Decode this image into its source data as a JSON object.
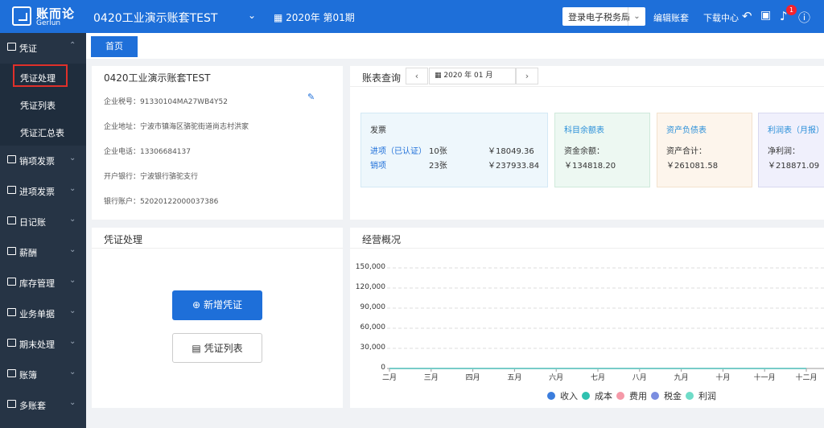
{
  "header": {
    "logo_cn": "账而论",
    "logo_en": "Gerlun",
    "company": "0420工业演示账套TEST",
    "period": "2020年 第01期",
    "login_tax": "登录电子税务局",
    "edit_ledger": "编辑账套",
    "download": "下载中心",
    "notify_count": "1"
  },
  "sidebar": {
    "voucher": "凭证",
    "voucher_process": "凭证处理",
    "voucher_list": "凭证列表",
    "voucher_summary": "凭证汇总表",
    "sales_invoice": "销项发票",
    "purchase_invoice": "进项发票",
    "journal": "日记账",
    "salary": "薪酬",
    "inventory": "库存管理",
    "business_docs": "业务单据",
    "period_end": "期末处理",
    "books": "账簿",
    "multi_ledger": "多账套"
  },
  "tabs": {
    "home": "首页"
  },
  "company_info": {
    "title": "0420工业演示账套TEST",
    "tax_id": "企业税号：91330104MA27WB4Y52",
    "address": "企业地址：宁波市镇海区骆驼街道尚志村洪家",
    "phone": "企业电话：13306684137",
    "bank": "开户银行：宁波银行骆驼支行",
    "account": "银行账户：52020122000037386"
  },
  "ledger_query": {
    "title": "账表查询",
    "date": "2020 年 01 月",
    "invoice": {
      "title": "发票",
      "in_label": "进项（已认证）",
      "in_count": "10张",
      "in_amount": "￥18049.36",
      "out_label": "销项",
      "out_count": "23张",
      "out_amount": "￥237933.84"
    },
    "balance": {
      "title": "科目余额表",
      "label": "资金余额：",
      "value": "￥134818.20"
    },
    "assets": {
      "title": "资产负债表",
      "label": "资产合计：",
      "value": "￥261081.58"
    },
    "profit": {
      "title": "利润表（月报）",
      "label": "净利润：",
      "value": "￥218871.09"
    }
  },
  "voucher_card": {
    "title": "凭证处理",
    "new_voucher": "新增凭证",
    "voucher_list": "凭证列表"
  },
  "chart_data": {
    "type": "line",
    "title": "经营概况",
    "categories": [
      "二月",
      "三月",
      "四月",
      "五月",
      "六月",
      "七月",
      "八月",
      "九月",
      "十月",
      "十一月",
      "十二月"
    ],
    "y_ticks": [
      "0",
      "30,000",
      "60,000",
      "90,000",
      "120,000",
      "150,000"
    ],
    "ylim": [
      0,
      150000
    ],
    "grid": true,
    "legend_position": "bottom",
    "series": [
      {
        "name": "收入",
        "color": "#3b7ddd",
        "values": [
          0,
          0,
          0,
          0,
          0,
          0,
          0,
          0,
          0,
          0,
          0
        ]
      },
      {
        "name": "成本",
        "color": "#2fc1b0",
        "values": [
          0,
          0,
          0,
          0,
          0,
          0,
          0,
          0,
          0,
          0,
          0
        ]
      },
      {
        "name": "费用",
        "color": "#f599a8",
        "values": [
          0,
          0,
          0,
          0,
          0,
          0,
          0,
          0,
          0,
          0,
          0
        ]
      },
      {
        "name": "税金",
        "color": "#7b8ee0",
        "values": [
          0,
          0,
          0,
          0,
          0,
          0,
          0,
          0,
          0,
          0,
          0
        ]
      },
      {
        "name": "利润",
        "color": "#6fdcc8",
        "values": [
          0,
          0,
          0,
          0,
          0,
          0,
          0,
          0,
          0,
          0,
          0
        ]
      }
    ]
  }
}
